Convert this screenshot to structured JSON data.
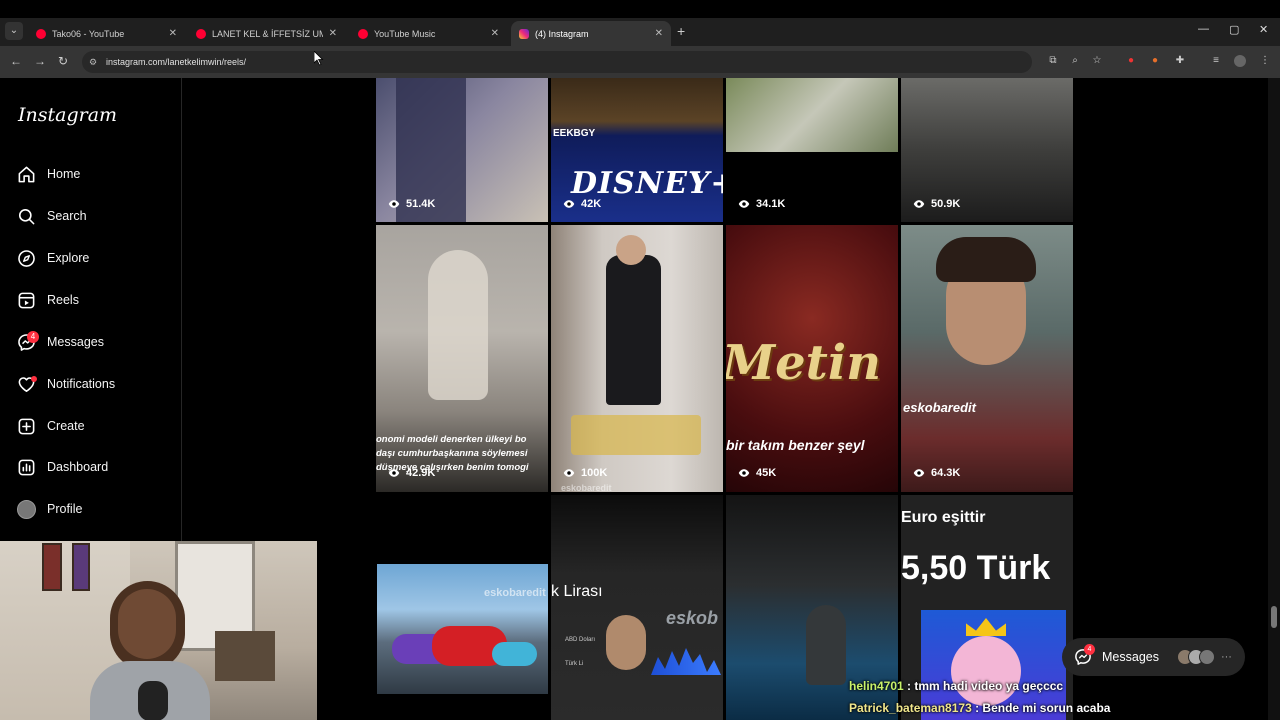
{
  "browser": {
    "tabs": [
      {
        "title": "Tako06 - YouTube",
        "favicon_color": "#ff0033"
      },
      {
        "title": "LANET KEL & İFFETSİZ UMUT ·",
        "favicon_color": "#ff0033"
      },
      {
        "title": "YouTube Music",
        "favicon_color": "#ff0033"
      },
      {
        "title": "(4) Instagram",
        "favicon_color": "#d6249f"
      }
    ],
    "url": "instagram.com/lanetkelimwin/reels/"
  },
  "sidebar": {
    "logo": "Instagram",
    "items": [
      {
        "label": "Home"
      },
      {
        "label": "Search"
      },
      {
        "label": "Explore"
      },
      {
        "label": "Reels"
      },
      {
        "label": "Messages",
        "badge": "4"
      },
      {
        "label": "Notifications"
      },
      {
        "label": "Create"
      },
      {
        "label": "Dashboard"
      },
      {
        "label": "Profile"
      }
    ]
  },
  "reels": [
    {
      "views": "51.4K"
    },
    {
      "views": "42K",
      "caption": "DISNEY+",
      "tag": "EEKBGY"
    },
    {
      "views": "34.1K"
    },
    {
      "views": "50.9K"
    },
    {
      "views": "42.9K",
      "caption": "onomi modeli denerken ülkeyi bo daşı cumhurbaşkanına söylemesi düşmeye çalışırken benim tomogi"
    },
    {
      "views": "100K",
      "watermark": "eskobaredit"
    },
    {
      "views": "45K",
      "caption": "Metin",
      "caption2": "bir takım benzer şeyl"
    },
    {
      "views": "64.3K",
      "watermark": "eskobaredit"
    },
    {
      "caption": "eskobaredit"
    },
    {
      "caption": "k Lirası",
      "watermark": "eskob",
      "subtitle1": "ABD Doları",
      "subtitle2": "Türk Li"
    },
    {},
    {
      "caption": "Euro eşittir",
      "caption2": "5,50 Türk"
    }
  ],
  "floating_messages": {
    "label": "Messages",
    "badge": "4"
  },
  "chat": [
    {
      "user": "helin4701",
      "message": ": tmm hadi video ya geçccc"
    },
    {
      "user": "Patrick_bateman8173",
      "message": ": Bende mi sorun acaba"
    }
  ]
}
